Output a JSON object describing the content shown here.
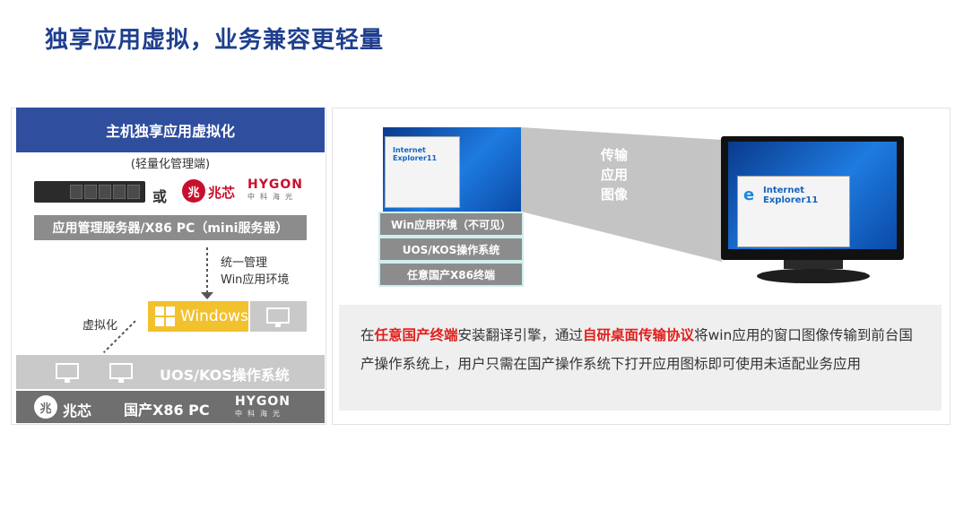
{
  "title": "独享应用虚拟，业务兼容更轻量",
  "left": {
    "header": "主机独享应用虚拟化",
    "subtitle": "(轻量化管理端)",
    "or_text": "或",
    "zhaoxin": {
      "icon": "zhaoxin-logo",
      "glyph": "兆",
      "text": "兆芯"
    },
    "hygon": {
      "main": "HYGON",
      "sub": "中科海光"
    },
    "mgmt_server": "应用管理服务器/X86 PC（mini服务器）",
    "manage_label_1": "统一管理",
    "manage_label_2": "Win应用环境",
    "windows_label": "Windows",
    "virt_label": "虚拟化",
    "os_label": "UOS/KOS操作系统",
    "pc_label": "国产X86 PC"
  },
  "right": {
    "beam_text": [
      "传输",
      "应用",
      "图像"
    ],
    "stack": [
      "Win应用环境（不可见）",
      "UOS/KOS操作系统",
      "任意国产X86终端"
    ],
    "ie_brand_1": "Internet",
    "ie_brand_2": "Explorer11",
    "desc": {
      "p1": "在",
      "h1": "任意国产终端",
      "p2": "安装翻译引擎，通过",
      "h2": "自研桌面传输协议",
      "p3": "将win应用的窗口图像传输到前台国产操作系统上，用户只需在国产操作系统下打开应用图标即可使用未适配业务应用"
    }
  },
  "colors": {
    "brand_blue": "#1e3f8f",
    "header_blue": "#2f4e9e",
    "highlight_red": "#e0201c",
    "windows_yellow": "#f2c12e"
  }
}
